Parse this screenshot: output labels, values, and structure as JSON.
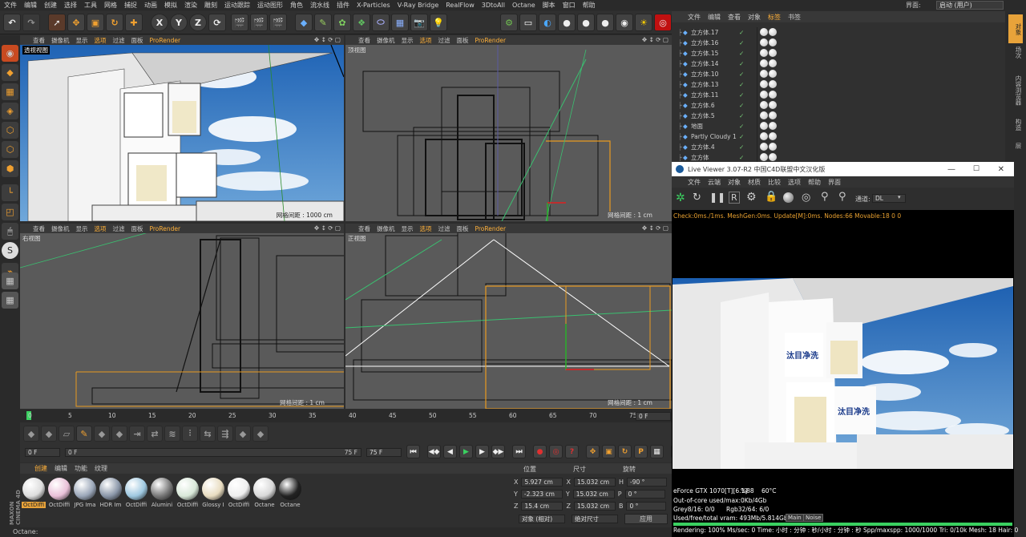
{
  "menubar": [
    "文件",
    "编辑",
    "创建",
    "选择",
    "工具",
    "网格",
    "捕捉",
    "动画",
    "模拟",
    "渲染",
    "雕刻",
    "运动跟踪",
    "运动图形",
    "角色",
    "流水线",
    "插件",
    "X-Particles",
    "V-Ray Bridge",
    "RealFlow",
    "3DtoAll",
    "Octane",
    "脚本",
    "窗口",
    "帮助"
  ],
  "layout": {
    "label": "界面:",
    "value": "启动 (用户)"
  },
  "viewport_menu": [
    "查看",
    "摄像机",
    "显示",
    "选项",
    "过滤",
    "面板",
    "ProRender"
  ],
  "viewports": [
    {
      "name": "透视视图",
      "grid": "网格间距 : 1000 cm"
    },
    {
      "name": "顶视图",
      "grid": "网格间距 : 1 cm"
    },
    {
      "name": "右视图",
      "grid": "网格间距 : 1 cm"
    },
    {
      "name": "正视图",
      "grid": "网格间距 : 1 cm"
    }
  ],
  "timeline": {
    "ticks": [
      "0",
      "5",
      "10",
      "15",
      "20",
      "25",
      "30",
      "35",
      "40",
      "45",
      "50",
      "55",
      "60",
      "65",
      "70",
      "75"
    ],
    "current": "0 F"
  },
  "transport": {
    "start": "0 F",
    "range_end": "75 F",
    "end": "75 F",
    "scrub_start": "0 F"
  },
  "materials": {
    "tabs": [
      "创建",
      "编辑",
      "功能",
      "纹理"
    ],
    "items": [
      {
        "label": "OctDiffi",
        "color": "#ddd"
      },
      {
        "label": "OctDiffi",
        "color": "#e9c0d8"
      },
      {
        "label": "JPG Ima",
        "color": "#9aa6b8"
      },
      {
        "label": "HDR Im",
        "color": "#8a96a8"
      },
      {
        "label": "OctDiffi",
        "color": "#9ec8e0"
      },
      {
        "label": "Alumini",
        "color": "#777"
      },
      {
        "label": "OctDiffi",
        "color": "#d8e8d8"
      },
      {
        "label": "Glossy I",
        "color": "#e8dcc0"
      },
      {
        "label": "OctDiffi",
        "color": "#eeeeee"
      },
      {
        "label": "Octane",
        "color": "#d8d8d8"
      },
      {
        "label": "Octane",
        "color": "#222"
      }
    ]
  },
  "coords": {
    "headers": [
      "位置",
      "尺寸",
      "旋转"
    ],
    "rows": [
      {
        "axis": "X",
        "pos": "5.927 cm",
        "size": "15.032 cm",
        "rlabel": "H",
        "rot": "-90 °"
      },
      {
        "axis": "Y",
        "pos": "-2.323 cm",
        "size": "15.032 cm",
        "rlabel": "P",
        "rot": "0 °"
      },
      {
        "axis": "Z",
        "pos": "15.4 cm",
        "size": "15.032 cm",
        "rlabel": "B",
        "rot": "0 °"
      }
    ],
    "mode1": "对象 (相对)",
    "mode2": "绝对尺寸",
    "apply": "应用"
  },
  "status": "Octane:",
  "objmgr": {
    "menu": [
      "文件",
      "编辑",
      "查看",
      "对象",
      "标签",
      "书签"
    ],
    "rows": [
      {
        "name": "立方体.17"
      },
      {
        "name": "立方体.16"
      },
      {
        "name": "立方体.15"
      },
      {
        "name": "立方体.14"
      },
      {
        "name": "立方体.10"
      },
      {
        "name": "立方体.13"
      },
      {
        "name": "立方体.11"
      },
      {
        "name": "立方体.6"
      },
      {
        "name": "立方体.5"
      },
      {
        "name": "地面"
      },
      {
        "name": "Partly Cloudy 1"
      },
      {
        "name": "立方体.4"
      },
      {
        "name": "立方体"
      }
    ]
  },
  "rightstrip": [
    "对象",
    "场次",
    "内容浏览器",
    "构造",
    "层"
  ],
  "liveviewer": {
    "title": "Live Viewer 3.07-R2 中国C4D联盟中文汉化版",
    "menu": [
      "文件",
      "云端",
      "对象",
      "材质",
      "比较",
      "选项",
      "帮助",
      "界面"
    ],
    "channel_label": "通道:",
    "channel": "DL",
    "check": "Check:0ms./1ms. MeshGen:0ms. Update[M]:0ms. Nodes:66 Movable:18  0 0",
    "gpu": "eForce GTX 1070[T][6.1]",
    "gpu_pct": "%88",
    "gpu_temp": "60°C",
    "ooc": "Out-of-core used/max:0Kb/4Gb",
    "grey": "Grey8/16: 0/0",
    "rgb": "Rgb32/64: 6/0",
    "vram": "Used/free/total vram: 493Mb/5.814Gb/8Gb",
    "main_btn": "Main",
    "noise_btn": "Noise",
    "rendering": "Rendering: 100%   Ms/sec: 0   Time: 小时 : 分钟 : 秒/小时 : 分钟 : 秒   Spp/maxspp: 1000/1000   Tri: 0/10k   Mesh: 18   Hair: 0"
  },
  "package_text": "汰目净洗"
}
